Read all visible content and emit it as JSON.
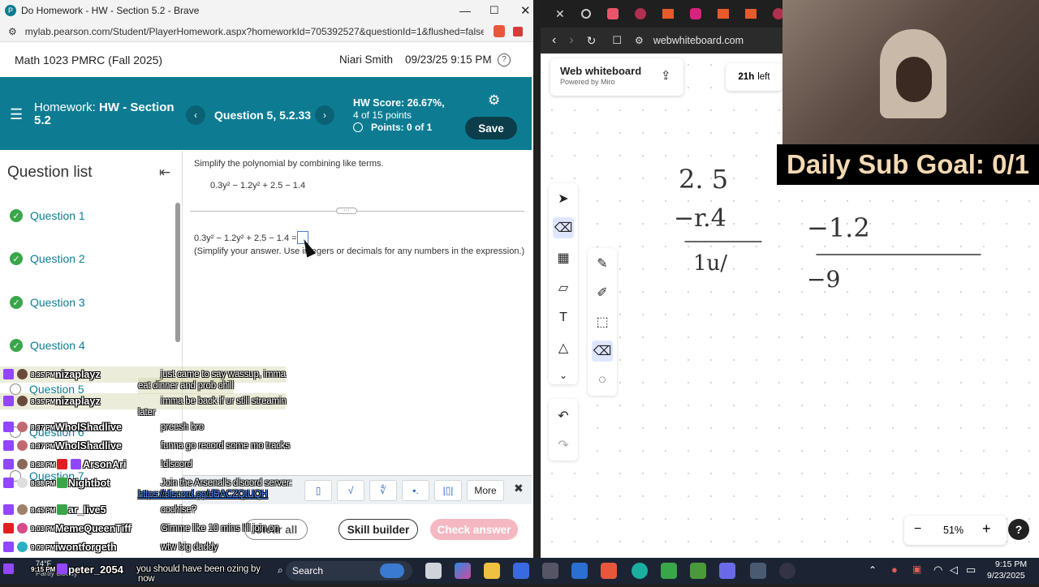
{
  "left_browser": {
    "title": "Do Homework - HW - Section 5.2 - Brave",
    "url": "mylab.pearson.com/Student/PlayerHomework.aspx?homeworkId=705392527&questionId=1&flushed=false...",
    "course": "Math 1023 PMRC (Fall 2025)",
    "student": "Niari Smith",
    "datetime": "09/23/25 9:15 PM",
    "hw_label": "Homework:",
    "hw_name": "HW - Section 5.2",
    "question_label": "Question 5, 5.2.33",
    "hw_score": "HW Score: 26.67%,",
    "hw_points": "4 of 15 points",
    "q_points": "Points: 0 of 1",
    "save": "Save",
    "question_list_title": "Question list",
    "questions": [
      "Question 1",
      "Question 2",
      "Question 3",
      "Question 4",
      "Question 5",
      "Question 6",
      "Question 7"
    ],
    "prompt": "Simplify the polynomial by combining like terms.",
    "expression": "0.3y² − 1.2y² + 2.5 − 1.4",
    "expression_eq": "0.3y² − 1.2y² + 2.5 − 1.4 =",
    "instruction": "(Simplify your answer. Use integers or decimals for any numbers in the expression.)",
    "more": "More",
    "clear_all": "Clear all",
    "skill_builder": "Skill builder",
    "check_answer": "Check answer"
  },
  "right_browser": {
    "url": "webwhiteboard.com",
    "board_title": "Web whiteboard",
    "board_sub": "Powered by Miro",
    "time_left": "21h",
    "time_left_suffix": "left",
    "zoom": "51%",
    "handwriting": [
      "2. 5",
      "−r.4",
      "1u/",
      "−1.2",
      "−9"
    ]
  },
  "stream": {
    "sub_goal": "Daily Sub Goal: 0/1"
  },
  "chat": [
    {
      "time": "8:35 PM",
      "user": "nizaplayz",
      "msg": "just came to say wassup, imma",
      "msg2": "eat dinner and prob chill"
    },
    {
      "time": "8:35 PM",
      "user": "nizaplayz",
      "msg": "imma be back if ur still streamin",
      "msg2": "later"
    },
    {
      "time": "8:37 PM",
      "user": "WhoIShadlive",
      "msg": "preesh bro",
      "msg2": ""
    },
    {
      "time": "8:37 PM",
      "user": "WhoIShadlive",
      "msg": "funna go record some mo tracks",
      "msg2": ""
    },
    {
      "time": "8:38 PM",
      "user": "ArsonAri",
      "msg": "!discord",
      "msg2": ""
    },
    {
      "time": "8:38 PM",
      "user": "Nightbot",
      "msg": "Join the Arsenal's discord server:",
      "msg2": "https://discord.gg/dBACZQtUQH"
    },
    {
      "time": "8:45 PM",
      "user": "ar_live5",
      "msg": "cochise?",
      "msg2": ""
    },
    {
      "time": "9:03 PM",
      "user": "MemeQueenTiff",
      "msg": "Gimme like 10 mins I'll join on",
      "msg2": ""
    },
    {
      "time": "9:09 PM",
      "user": "iwontforgeth",
      "msg": "wtw big daddy",
      "msg2": ""
    },
    {
      "time": "9:15 PM",
      "user": "peter_2054",
      "msg": "you should have been ozing by",
      "msg2": "now"
    }
  ],
  "taskbar": {
    "weather_temp": "74°F",
    "weather_desc": "Partly cloudy",
    "search": "Search",
    "time": "9:15 PM",
    "date": "9/23/2025"
  }
}
